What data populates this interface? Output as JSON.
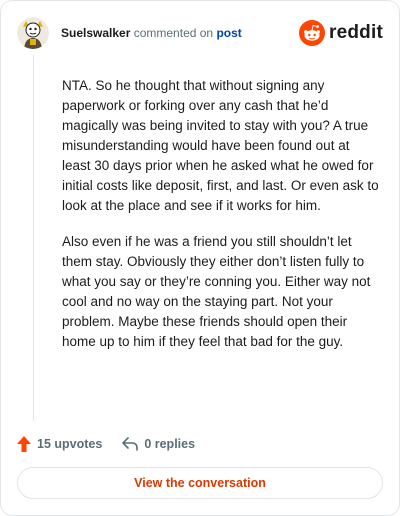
{
  "header": {
    "username": "Suelswalker",
    "commented_on_text": "commented on",
    "post_link_text": "post",
    "brand_wordmark": "reddit",
    "brand_color": "#ff4500"
  },
  "comment": {
    "paragraphs": [
      "NTA. So he thought that without signing any paperwork or forking over any cash that he’d magically was being invited to stay with you? A true misunderstanding would have been found out at least 30 days prior when he asked what he owed for initial costs like deposit, first, and last. Or even ask to look at the place and see if it works for him.",
      "Also even if he was a friend you still shouldn’t let them stay. Obviously they either don’t listen fully to what you say or they’re conning you. Either way not cool and no way on the staying part. Not your problem. Maybe these friends should open their home up to him if they feel that bad for the guy."
    ]
  },
  "actions": {
    "upvotes_label": "15 upvotes",
    "upvote_icon": "upvote-arrow-icon",
    "replies_label": "0 replies",
    "reply_icon": "reply-arrow-icon"
  },
  "cta": {
    "label": "View the conversation",
    "color": "#d93900"
  }
}
